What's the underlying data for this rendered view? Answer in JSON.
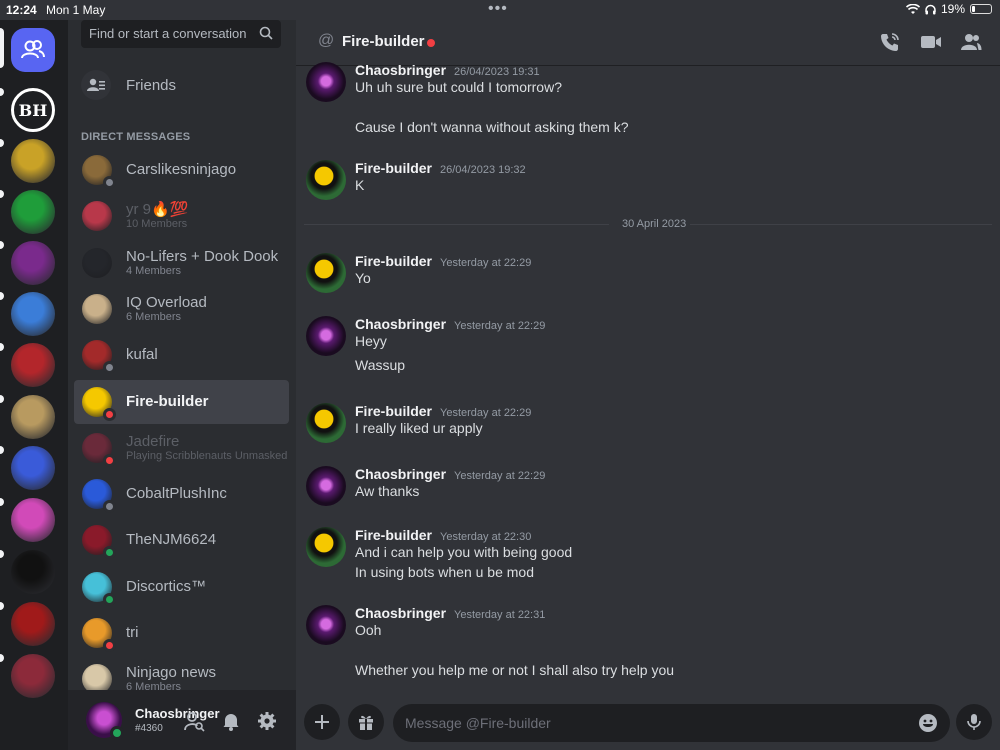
{
  "status_bar": {
    "time": "12:24",
    "date": "Mon 1 May",
    "battery": "19%",
    "battery_level": 0.19
  },
  "rail": {
    "home_label": "Direct Messages",
    "servers": [
      {
        "name": "BH",
        "color": "#ffffff",
        "text": "BH"
      },
      {
        "name": "server-2",
        "color": "#c9a227"
      },
      {
        "name": "server-3",
        "color": "#1f9d3a"
      },
      {
        "name": "server-4",
        "color": "#7a2a8c"
      },
      {
        "name": "server-5",
        "color": "#3b7dd8"
      },
      {
        "name": "server-6",
        "color": "#b3262b"
      },
      {
        "name": "server-7",
        "color": "#b89a60"
      },
      {
        "name": "server-8",
        "color": "#3a5bd9"
      },
      {
        "name": "server-9",
        "color": "#d14ab8"
      },
      {
        "name": "server-10",
        "color": "#111111"
      },
      {
        "name": "server-11",
        "color": "#a01a1a"
      },
      {
        "name": "server-12",
        "color": "#8c2a3a"
      }
    ]
  },
  "dm_panel": {
    "search_placeholder": "Find or start a conversation",
    "friends_label": "Friends",
    "section_header": "DIRECT MESSAGES",
    "items": [
      {
        "name": "Carslikesninjago",
        "sub": "",
        "status": "offline",
        "color": "#8a6a3a"
      },
      {
        "name": "yr 9🔥💯",
        "sub": "10 Members",
        "status": "",
        "color": "#b8384a",
        "dim": true
      },
      {
        "name": "No-Lifers + Dook Dook",
        "sub": "4 Members",
        "status": "",
        "color": "#24262b"
      },
      {
        "name": "IQ Overload",
        "sub": "6 Members",
        "status": "",
        "color": "#c9b08a"
      },
      {
        "name": "kufal",
        "sub": "",
        "status": "offline",
        "color": "#a32a2a"
      },
      {
        "name": "Fire-builder",
        "sub": "",
        "status": "dnd",
        "color": "#f5c800",
        "selected": true
      },
      {
        "name": "Jadefire",
        "sub": "Playing Scribblenauts Unmasked",
        "status": "dnd",
        "color": "#6a2a3a",
        "dim": true
      },
      {
        "name": "CobaltPlushInc",
        "sub": "",
        "status": "offline",
        "color": "#2a5ad9"
      },
      {
        "name": "TheNJM6624",
        "sub": "",
        "status": "online",
        "color": "#8a1a2a"
      },
      {
        "name": "Discortics™",
        "sub": "",
        "status": "online",
        "color": "#46c0d8"
      },
      {
        "name": "tri",
        "sub": "",
        "status": "dnd",
        "color": "#e89a2a"
      },
      {
        "name": "Ninjago news",
        "sub": "6 Members",
        "status": "",
        "color": "#d8c8a8"
      }
    ]
  },
  "user_panel": {
    "username": "Chaosbringer",
    "tag": "#4360"
  },
  "chat": {
    "recipient": "Fire-builder",
    "at_symbol": "@",
    "divider_label": "30 April 2023",
    "input_placeholder": "Message @Fire-builder",
    "messages": [
      {
        "author": "Chaosbringer",
        "avatar": "chaos",
        "time": "26/04/2023 19:31",
        "lines": [
          "Uh uh sure but could I tomorrow?",
          "",
          "Cause I don't wanna without asking them k?"
        ]
      },
      {
        "author": "Fire-builder",
        "avatar": "fire",
        "time": "26/04/2023 19:32",
        "lines": [
          "K"
        ]
      },
      {
        "author": "Fire-builder",
        "avatar": "fire",
        "time": "Yesterday at 22:29",
        "lines": [
          "Yo"
        ]
      },
      {
        "author": "Chaosbringer",
        "avatar": "chaos",
        "time": "Yesterday at 22:29",
        "lines": [
          "Heyy",
          "Wassup"
        ]
      },
      {
        "author": "Fire-builder",
        "avatar": "fire",
        "time": "Yesterday at 22:29",
        "lines": [
          "I really liked ur apply"
        ]
      },
      {
        "author": "Chaosbringer",
        "avatar": "chaos",
        "time": "Yesterday at 22:29",
        "lines": [
          "Aw thanks"
        ]
      },
      {
        "author": "Fire-builder",
        "avatar": "fire",
        "time": "Yesterday at 22:30",
        "lines": [
          "And i can help you with being good",
          "In using bots when u be mod"
        ]
      },
      {
        "author": "Chaosbringer",
        "avatar": "chaos",
        "time": "Yesterday at 22:31",
        "lines": [
          "Ooh",
          "",
          "Whether you help me or not I shall also try help you"
        ]
      }
    ]
  }
}
